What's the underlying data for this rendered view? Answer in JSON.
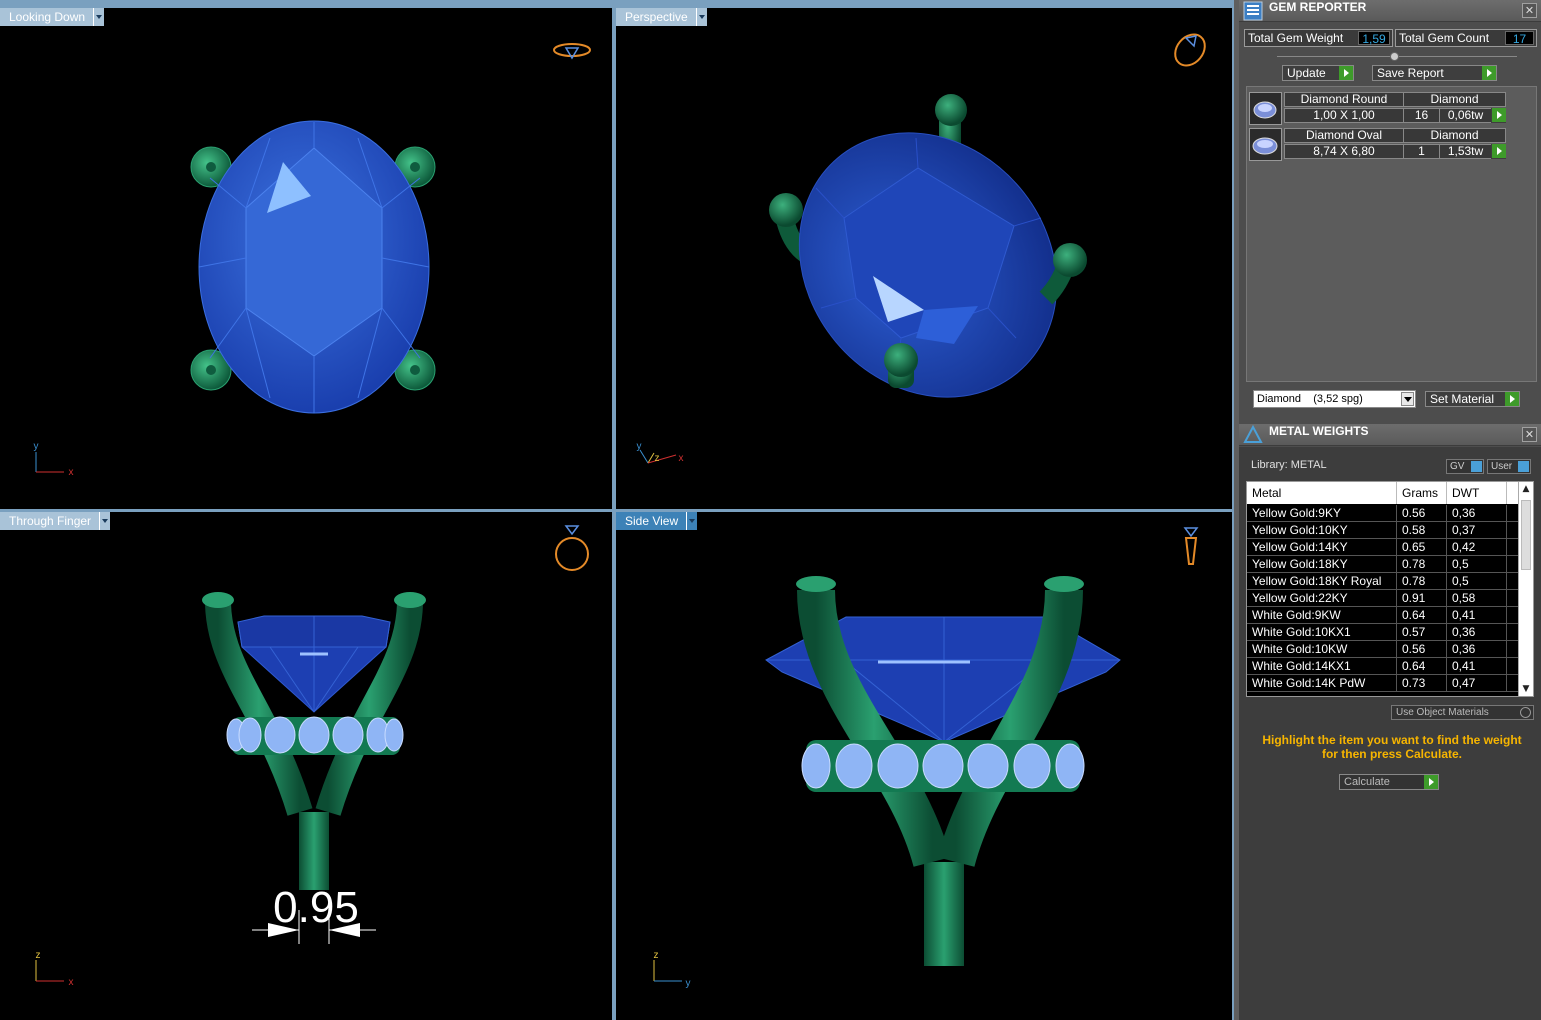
{
  "viewports": {
    "top_left": {
      "label": "Looking Down"
    },
    "top_right": {
      "label": "Perspective"
    },
    "bottom_left": {
      "label": "Through Finger",
      "dimension": "0.95"
    },
    "bottom_right": {
      "label": "Side View"
    }
  },
  "axes": {
    "looking_down": [
      "y",
      "x"
    ],
    "perspective": [
      "y",
      "z",
      "x"
    ],
    "through_finger": [
      "z",
      "x"
    ],
    "side_view": [
      "z",
      "y"
    ]
  },
  "gem_reporter": {
    "title": "GEM REPORTER",
    "total_weight_label": "Total Gem Weight",
    "total_weight_value": "1,59",
    "total_count_label": "Total Gem Count",
    "total_count_value": "17",
    "update_label": "Update",
    "save_report_label": "Save Report",
    "gems": [
      {
        "name": "Diamond Round",
        "material": "Diamond",
        "size": "1,00 X 1,00",
        "count": "16",
        "weight": "0,06tw"
      },
      {
        "name": "Diamond Oval",
        "material": "Diamond",
        "size": "8,74 X 6,80",
        "count": "1",
        "weight": "1,53tw"
      }
    ],
    "material_select": "Diamond    (3,52 spg)",
    "set_material_label": "Set Material"
  },
  "metal_weights": {
    "title": "METAL WEIGHTS",
    "library_label": "Library: METAL",
    "gv_label": "GV",
    "user_label": "User",
    "columns": [
      "Metal",
      "Grams",
      "DWT"
    ],
    "rows": [
      [
        "Yellow Gold:9KY",
        "0.56",
        "0,36"
      ],
      [
        "Yellow Gold:10KY",
        "0.58",
        "0,37"
      ],
      [
        "Yellow Gold:14KY",
        "0.65",
        "0,42"
      ],
      [
        "Yellow Gold:18KY",
        "0.78",
        "0,5"
      ],
      [
        "Yellow Gold:18KY Royal",
        "0.78",
        "0,5"
      ],
      [
        "Yellow Gold:22KY",
        "0.91",
        "0,58"
      ],
      [
        "White Gold:9KW",
        "0.64",
        "0,41"
      ],
      [
        "White Gold:10KX1",
        "0.57",
        "0,36"
      ],
      [
        "White Gold:10KW",
        "0.56",
        "0,36"
      ],
      [
        "White Gold:14KX1",
        "0.64",
        "0,41"
      ],
      [
        "White Gold:14K PdW",
        "0.73",
        "0,47"
      ]
    ],
    "use_object_materials_label": "Use Object Materials",
    "hint": "Highlight the item you want to find the weight for then press Calculate.",
    "calculate_label": "Calculate"
  },
  "colors": {
    "gem_blue": "#1f4fc4",
    "prong_green": "#1f8a5e",
    "label_active": "#3d82b7",
    "label_inactive": "#a9c3d8",
    "accent_green": "#3e9b2a",
    "hint_orange": "#f7b500"
  }
}
